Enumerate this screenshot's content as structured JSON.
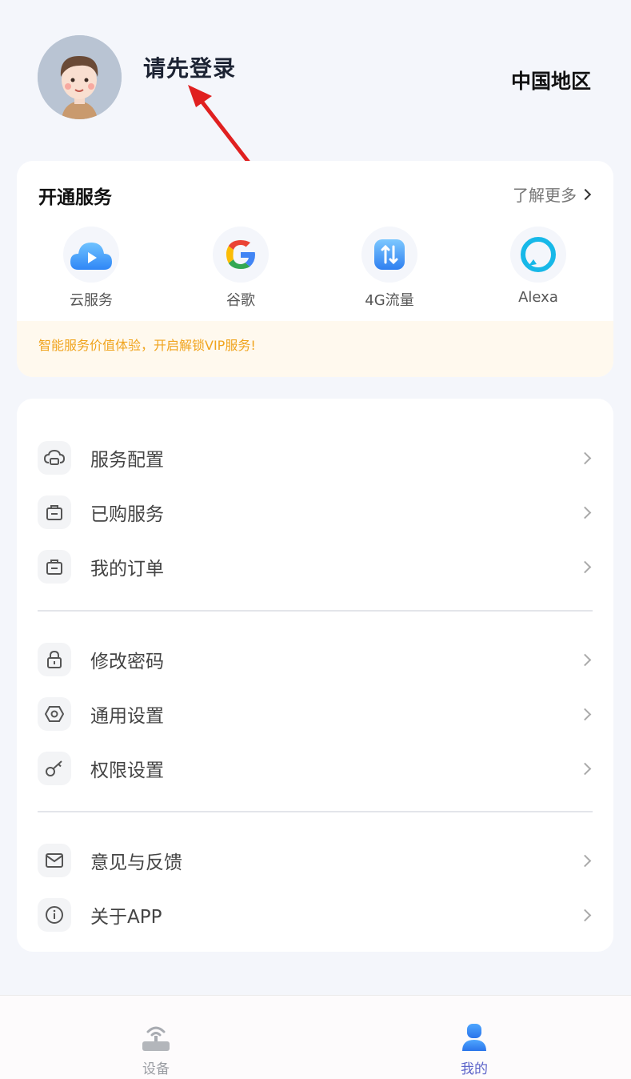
{
  "header": {
    "login_prompt": "请先登录",
    "region": "中国地区"
  },
  "services": {
    "title": "开通服务",
    "more_label": "了解更多",
    "items": [
      {
        "label": "云服务",
        "icon": "cloud-play-icon"
      },
      {
        "label": "谷歌",
        "icon": "google-icon"
      },
      {
        "label": "4G流量",
        "icon": "cellular-data-icon"
      },
      {
        "label": "Alexa",
        "icon": "alexa-icon"
      }
    ],
    "vip_tip": "智能服务价值体验，开启解锁VIP服务!"
  },
  "menu": {
    "group1": [
      {
        "label": "服务配置",
        "icon": "cloud-config-icon"
      },
      {
        "label": "已购服务",
        "icon": "bag-icon"
      },
      {
        "label": "我的订单",
        "icon": "order-icon"
      }
    ],
    "group2": [
      {
        "label": "修改密码",
        "icon": "lock-icon"
      },
      {
        "label": "通用设置",
        "icon": "hex-settings-icon"
      },
      {
        "label": "权限设置",
        "icon": "key-icon"
      }
    ],
    "group3": [
      {
        "label": "意见与反馈",
        "icon": "mail-icon"
      },
      {
        "label": "关于APP",
        "icon": "info-icon"
      }
    ]
  },
  "tabbar": {
    "tabs": [
      {
        "label": "设备",
        "icon": "device-router-icon",
        "color": "#9a9da3"
      },
      {
        "label": "我的",
        "icon": "person-icon",
        "color": "#5b63c9"
      }
    ]
  },
  "colors": {
    "accent": "#2f86f6",
    "vip_text": "#f0a41e",
    "annotation_arrow": "#e02020"
  }
}
